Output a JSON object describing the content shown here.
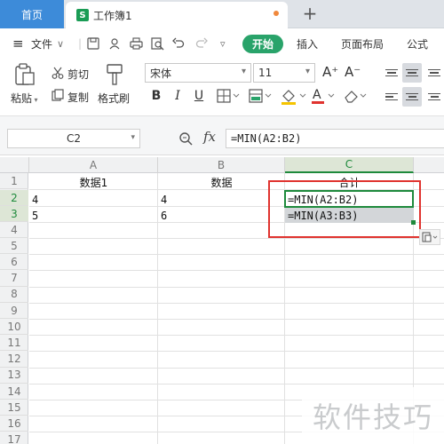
{
  "tabs": {
    "home": "首页",
    "doc_icon": "S",
    "doc": "工作簿1",
    "new_tab": "+"
  },
  "menu": {
    "hamburger": "≡",
    "file": "文件",
    "file_caret": "∨",
    "more_caret": "▿",
    "start": "开始",
    "insert": "插入",
    "page_layout": "页面布局",
    "formula": "公式",
    "toolbar_icons": [
      "save-icon",
      "share-icon",
      "print-icon",
      "print-preview-icon",
      "undo-icon",
      "redo-icon"
    ]
  },
  "ribbon": {
    "paste": "粘贴",
    "cut": "剪切",
    "copy": "复制",
    "format_painter": "格式刷",
    "font_name": "宋体",
    "font_size": "11",
    "grow_font": "A⁺",
    "shrink_font": "A⁻",
    "bold": "B",
    "italic": "I",
    "underline": "U"
  },
  "formula_bar": {
    "name_box": "C2",
    "fx": "fx",
    "formula": "=MIN(A2:B2)"
  },
  "columns": [
    "A",
    "B",
    "C"
  ],
  "rows": [
    "1",
    "2",
    "3",
    "4",
    "5",
    "6",
    "7",
    "8",
    "9",
    "10",
    "11",
    "12",
    "13",
    "14",
    "15",
    "16",
    "17"
  ],
  "cells": {
    "A1": "数据1",
    "B1": "数据",
    "C1": "合计",
    "A2": "4",
    "B2": "4",
    "C2": "=MIN(A2:B2)",
    "A3": "5",
    "B3": "6",
    "C3": "=MIN(A3:B3)"
  },
  "colors": {
    "accent_green": "#1e8a3c",
    "start_pill": "#29a36a",
    "home_tab": "#3d8bd9",
    "highlight_red": "#e0332f"
  },
  "watermark": "软件技巧"
}
